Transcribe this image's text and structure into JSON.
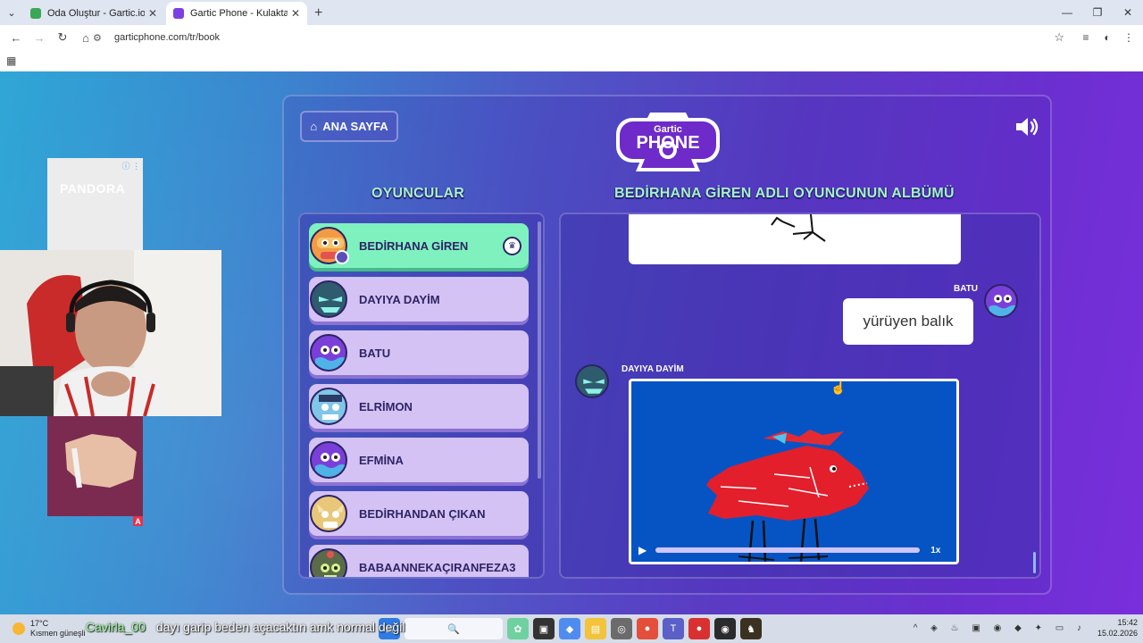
{
  "browser": {
    "tabs": [
      {
        "title": "Oda Oluştur - Gartic.io",
        "active": false,
        "favicon_color": "#3aa757"
      },
      {
        "title": "Gartic Phone - Kulaktan Kulağa",
        "active": true,
        "favicon_color": "#7b3fe4"
      }
    ],
    "url": "garticphone.com/tr/book"
  },
  "game": {
    "home_label": "ANA SAYFA",
    "logo_top": "Gartic",
    "logo_bottom": "PHONE",
    "players_title": "OYUNCULAR",
    "album_title": "BEDİRHANA GİREN ADLI OYUNCUNUN ALBÜMÜ",
    "players": [
      {
        "name": "BEDİRHANA GİREN",
        "host": true
      },
      {
        "name": "DAYIYA DAYİM",
        "host": false
      },
      {
        "name": "BATU",
        "host": false
      },
      {
        "name": "ELRİMON",
        "host": false
      },
      {
        "name": "EFMİNA",
        "host": false
      },
      {
        "name": "BEDİRHANDAN ÇIKAN",
        "host": false
      },
      {
        "name": "BABAANNEKAÇIRANFEZA3",
        "host": false
      }
    ],
    "album": {
      "text_author": "BATU",
      "text_guess": "yürüyen balık",
      "drawing_author": "DAYIYA DAYİM",
      "playback_speed": "1x",
      "playback_progress": 0.0
    }
  },
  "overlay": {
    "ad_label": "PANDORA",
    "ad_info": "ⓘ ⋮",
    "ad_flag": "A"
  },
  "taskbar": {
    "temperature": "17°C",
    "weather_text": "Kısmen güneşli",
    "chat_user": "Cavirla_00",
    "chat_message": "dayı garip beden açacaktın amk normal değil",
    "time": "15:42",
    "date": "15.02.2026"
  }
}
